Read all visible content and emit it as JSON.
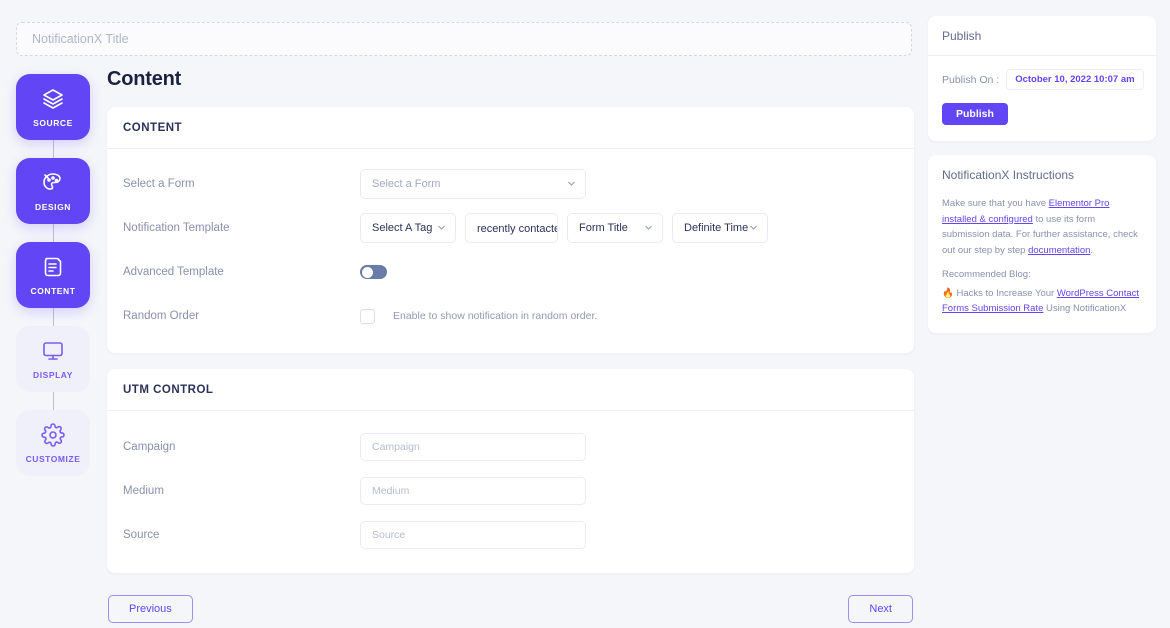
{
  "header": {
    "title_value": "",
    "title_placeholder": "NotificationX Title"
  },
  "stepper": {
    "steps": [
      {
        "label": "SOURCE",
        "icon": "layers-icon",
        "state": "active"
      },
      {
        "label": "DESIGN",
        "icon": "palette-icon",
        "state": "active"
      },
      {
        "label": "CONTENT",
        "icon": "document-icon",
        "state": "active"
      },
      {
        "label": "DISPLAY",
        "icon": "monitor-icon",
        "state": "inactive"
      },
      {
        "label": "CUSTOMIZE",
        "icon": "gear-icon",
        "state": "inactive"
      }
    ]
  },
  "main": {
    "page_title": "Content",
    "content_card": {
      "heading": "CONTENT",
      "select_form": {
        "label": "Select a Form",
        "value": "Select a Form"
      },
      "notification_template": {
        "label": "Notification Template",
        "tag": "Select A Tag",
        "recent": "recently contacted ↘",
        "form_title": "Form Title",
        "definite_time": "Definite Time"
      },
      "advanced_template": {
        "label": "Advanced Template",
        "enabled": false
      },
      "random_order": {
        "label": "Random Order",
        "checkbox_text": "Enable to show notification in random order.",
        "checked": false
      }
    },
    "utm_card": {
      "heading": "UTM CONTROL",
      "fields": [
        {
          "label": "Campaign",
          "value": "",
          "placeholder": "Campaign"
        },
        {
          "label": "Medium",
          "value": "",
          "placeholder": "Medium"
        },
        {
          "label": "Source",
          "value": "",
          "placeholder": "Source"
        }
      ]
    },
    "nav": {
      "previous": "Previous",
      "next": "Next"
    }
  },
  "right": {
    "publish": {
      "heading": "Publish",
      "publish_on_label": "Publish On :",
      "publish_on_value": "October 10, 2022 10:07 am",
      "publish_button": "Publish"
    },
    "instructions": {
      "heading": "NotificationX Instructions",
      "para1_a": "Make sure that you have ",
      "para1_link1": "Elementor Pro installed & configured",
      "para1_b": " to use its form submission data. For further assistance, check out our step by step ",
      "para1_link2": "documentation",
      "para1_c": ".",
      "recommended_label": "Recommended Blog:",
      "blog_emoji": "🔥",
      "blog_a": " Hacks to Increase Your ",
      "blog_link": "WordPress Contact Forms Submission Rate",
      "blog_b": " Using NotificationX"
    }
  },
  "colors": {
    "accent": "#6245f4",
    "accent_soft": "#f0f0fb",
    "page_bg": "#f5f6fa",
    "card_bg": "#ffffff",
    "text_dark": "#1b2141",
    "text_muted": "#8a90ad"
  }
}
